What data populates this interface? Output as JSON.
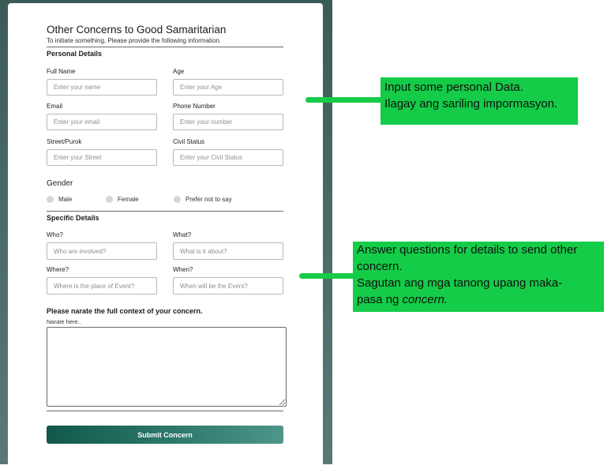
{
  "form": {
    "title": "Other Concerns to Good Samaritarian",
    "subtitle": "To initiate something, Please provide the following information.",
    "personal_section": "Personal Details",
    "fields": {
      "full_name": {
        "label": "Full Name",
        "placeholder": "Enter your name"
      },
      "age": {
        "label": "Age",
        "placeholder": "Enter your Age"
      },
      "email": {
        "label": "Email",
        "placeholder": "Enter your email"
      },
      "phone": {
        "label": "Phone Number",
        "placeholder": "Enter your number"
      },
      "street": {
        "label": "Street/Purok",
        "placeholder": "Enter your Street"
      },
      "civil_status": {
        "label": "Civil Status",
        "placeholder": "Enter your Civil Status"
      }
    },
    "gender": {
      "label": "Gender",
      "options": [
        "Male",
        "Female",
        "Prefer not to say"
      ]
    },
    "specific_section": "Specific Details",
    "specific": {
      "who": {
        "label": "Who?",
        "placeholder": "Who are involved?"
      },
      "what": {
        "label": "What?",
        "placeholder": "What is it about?"
      },
      "where": {
        "label": "Where?",
        "placeholder": "Where is the place of Event?"
      },
      "when": {
        "label": "When?",
        "placeholder": "When will be the Event?"
      }
    },
    "narrate": {
      "title": "Please narate the full context of your concern.",
      "label": "Narate here.."
    },
    "submit_label": "Submit Concern"
  },
  "notes": {
    "personal": {
      "line1": "Input some personal Data.",
      "line2": "Ilagay ang sariling impormasyon."
    },
    "specific": {
      "line1": "Answer questions for details to send other",
      "line2": "concern.",
      "line3": "Sagutan ang mga tanong upang maka-",
      "line4_prefix": "pasa ng ",
      "line4_emph": "concern."
    }
  },
  "colors": {
    "accent_green": "#14cc48",
    "submit_start": "#11584a",
    "submit_end": "#4f958a",
    "backdrop": "#4a6a66"
  }
}
